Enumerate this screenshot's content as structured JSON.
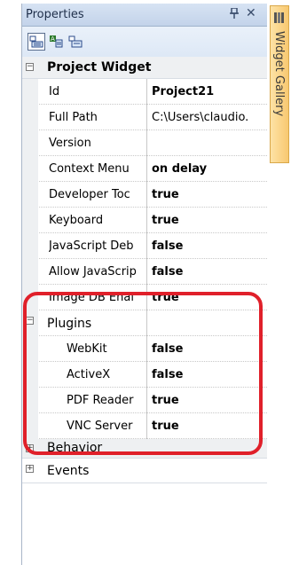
{
  "panel": {
    "title": "Properties",
    "pin_glyph": "ᵽ",
    "close_glyph": "✕"
  },
  "toolbar": {
    "buttons": [
      {
        "name": "categorized-view-icon",
        "active": true
      },
      {
        "name": "alphabetical-view-icon",
        "active": false
      },
      {
        "name": "property-pages-icon",
        "active": false
      }
    ]
  },
  "grid": {
    "project_category": {
      "toggle": "−",
      "label": "Project Widget"
    },
    "project_rows": [
      {
        "name": "Id",
        "value": "Project21"
      },
      {
        "name": "Full Path",
        "value": "C:\\Users\\claudio.",
        "plain": true
      },
      {
        "name": "Version",
        "value": ""
      },
      {
        "name": "Context Menu",
        "value": "on delay"
      },
      {
        "name": "Developer Toc",
        "value": "true"
      },
      {
        "name": "Keyboard",
        "value": "true"
      },
      {
        "name": "JavaScript Deb",
        "value": "false"
      },
      {
        "name": "Allow JavaScrip",
        "value": "false"
      },
      {
        "name": "Image DB Enal",
        "value": "true"
      }
    ],
    "plugins_category": {
      "toggle": "−",
      "label": "Plugins"
    },
    "plugin_rows": [
      {
        "name": "WebKit",
        "value": "false"
      },
      {
        "name": "ActiveX",
        "value": "false"
      },
      {
        "name": "PDF Reader",
        "value": "true"
      },
      {
        "name": "VNC Server",
        "value": "true"
      }
    ],
    "behavior_category": {
      "toggle": "+",
      "label": "Behavior"
    },
    "events_category": {
      "toggle": "+",
      "label": "Events"
    }
  },
  "side_tab": {
    "label": "Widget Gallery",
    "icon": "widget-gallery-icon"
  },
  "colors": {
    "highlight": "#e0202a",
    "side_tab": "#f8c870",
    "title_bar": "#c3d3ea"
  }
}
